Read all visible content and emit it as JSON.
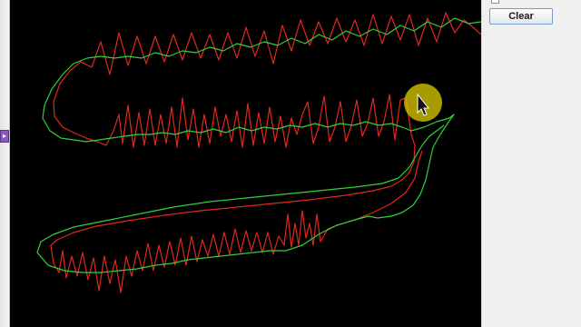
{
  "window": {
    "side_tab_glyph": "▸"
  },
  "controls": {
    "clear_label": "Clear",
    "checkbox_label": "",
    "checkbox_checked": false
  },
  "colors": {
    "canvas_background": "#000000",
    "raw_trace": "#e0281c",
    "smoothed_trace": "#2fd13a",
    "cursor_highlight": "#d6c600"
  },
  "icons": {
    "pointer": "mouse-pointer-icon",
    "highlight": "cursor-highlight-icon"
  }
}
